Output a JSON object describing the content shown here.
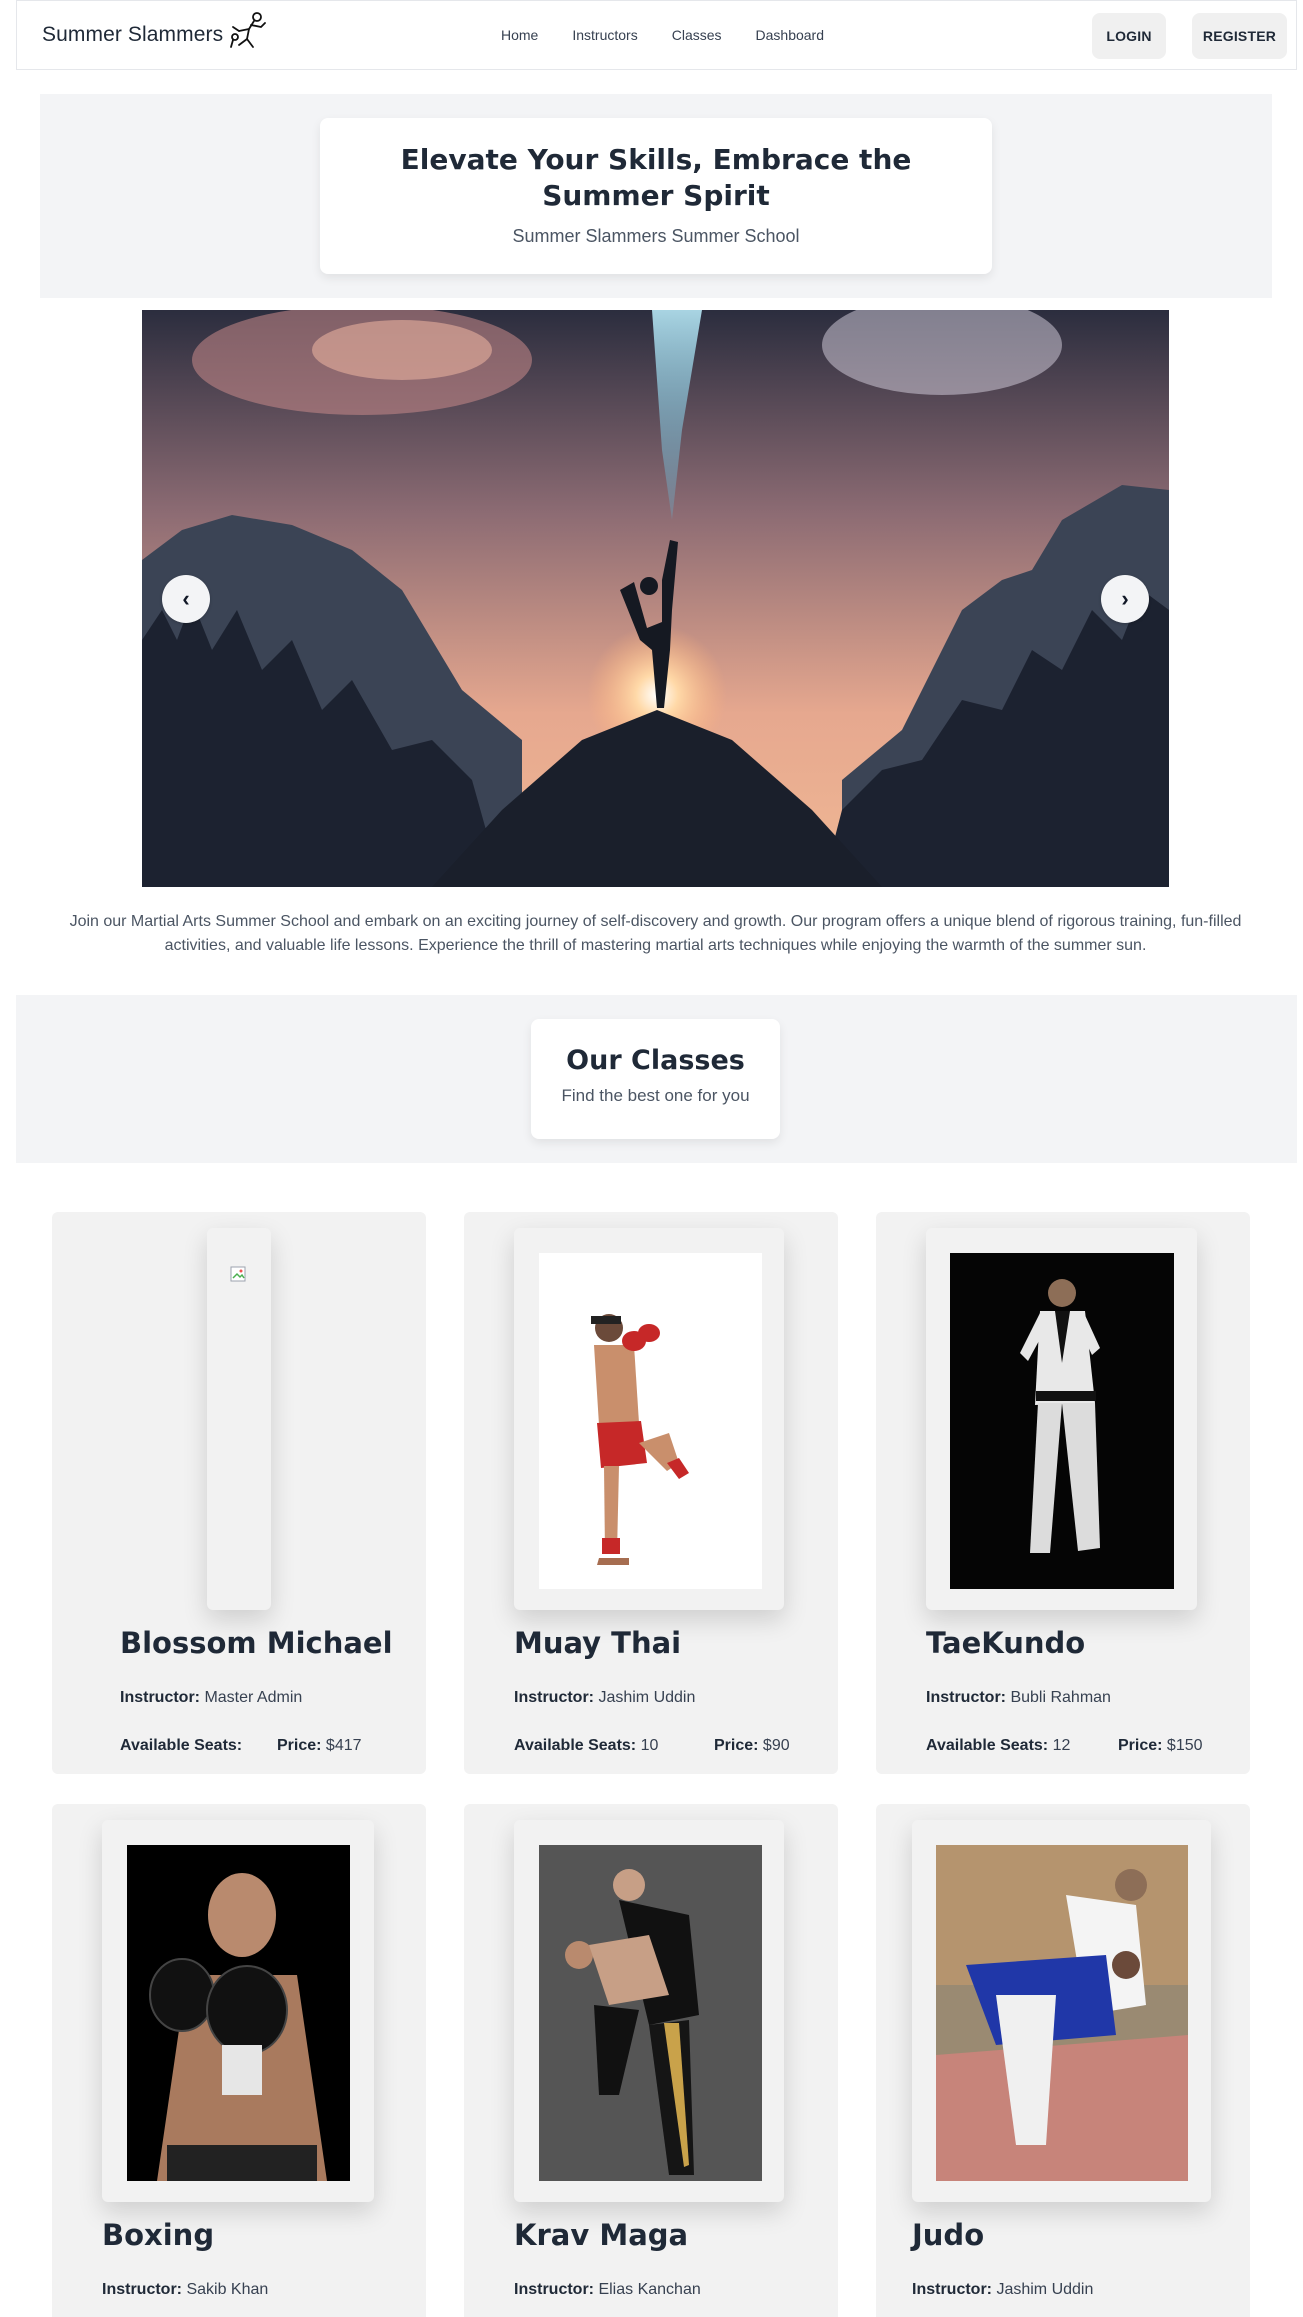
{
  "nav": {
    "brand": "Summer Slammers",
    "links": [
      "Home",
      "Instructors",
      "Classes",
      "Dashboard"
    ],
    "login": "LOGIN",
    "register": "REGISTER"
  },
  "hero": {
    "title": "Elevate Your Skills, Embrace the Summer Spirit",
    "subtitle": "Summer Slammers Summer School"
  },
  "carousel": {
    "prev": "‹",
    "next": "›"
  },
  "intro": "Join our Martial Arts Summer School and embark on an exciting journey of self-discovery and growth. Our program offers a unique blend of rigorous training, fun-filled activities, and valuable life lessons. Experience the thrill of mastering martial arts techniques while enjoying the warmth of the summer sun.",
  "classes_section": {
    "title": "Our Classes",
    "subtitle": "Find the best one for you"
  },
  "labels": {
    "instructor": "Instructor:",
    "seats": "Available Seats:",
    "price": "Price:"
  },
  "classes": [
    {
      "name": "Blossom Michael",
      "instructor": "Master Admin",
      "seats": "",
      "price": "$417"
    },
    {
      "name": "Muay Thai",
      "instructor": "Jashim Uddin",
      "seats": "10",
      "price": "$90"
    },
    {
      "name": "TaeKundo",
      "instructor": "Bubli Rahman",
      "seats": "12",
      "price": "$150"
    },
    {
      "name": "Boxing",
      "instructor": "Sakib Khan"
    },
    {
      "name": "Krav Maga",
      "instructor": "Elias Kanchan"
    },
    {
      "name": "Judo",
      "instructor": "Jashim Uddin"
    }
  ]
}
